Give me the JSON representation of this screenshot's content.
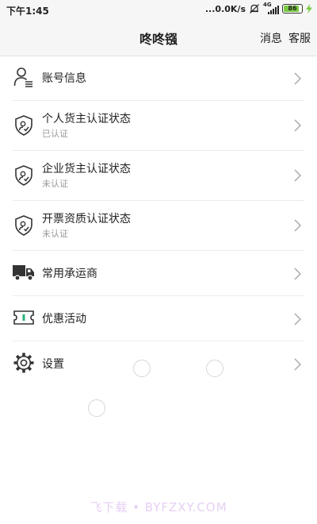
{
  "status_bar": {
    "time": "下午1:45",
    "network_speed": "...0.0K/s",
    "network_type": "4G",
    "battery_level": "86",
    "battery_fraction": 0.86,
    "icons": [
      "mute-icon",
      "signal-icon",
      "battery-icon",
      "charging-icon"
    ]
  },
  "header": {
    "title": "咚咚镪",
    "messages_label": "消息",
    "service_label": "客服"
  },
  "menu": {
    "items": [
      {
        "label": "账号信息",
        "sub": "",
        "icon": "user-icon"
      },
      {
        "label": "个人货主认证状态",
        "sub": "已认证",
        "icon": "shield-icon"
      },
      {
        "label": "企业货主认证状态",
        "sub": "未认证",
        "icon": "shield-icon"
      },
      {
        "label": "开票资质认证状态",
        "sub": "未认证",
        "icon": "shield-icon"
      },
      {
        "label": "常用承运商",
        "sub": "",
        "icon": "truck-icon"
      },
      {
        "label": "优惠活动",
        "sub": "",
        "icon": "ticket-icon"
      },
      {
        "label": "设置",
        "sub": "",
        "icon": "gear-icon"
      }
    ]
  },
  "watermark": "飞下载 • BYFZXY.COM",
  "colors": {
    "bar_background": "#f6f6f6",
    "divider": "#ececec",
    "subtext": "#999999",
    "battery_fill": "#7ac943"
  }
}
